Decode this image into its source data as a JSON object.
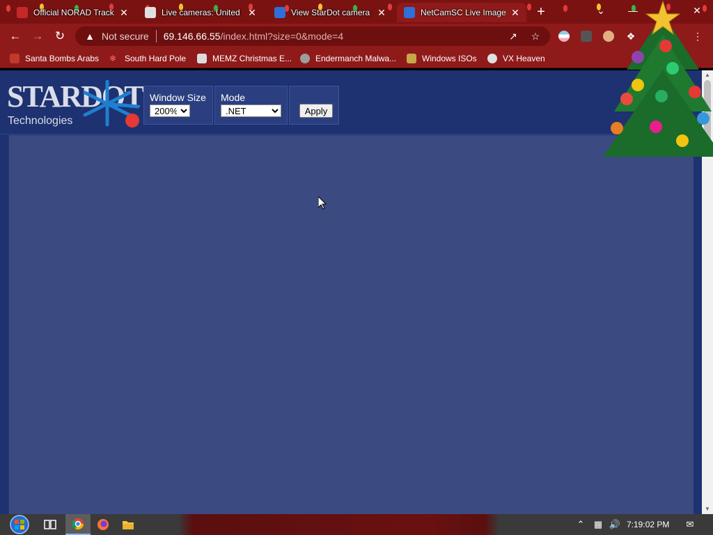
{
  "browser": {
    "tabs": [
      {
        "title": "Official NORAD Tracks",
        "icon": "norad-icon",
        "active": false
      },
      {
        "title": "Live cameras: United S",
        "icon": "camera-icon",
        "active": false
      },
      {
        "title": "View StarDot camera i",
        "icon": "stardot-icon",
        "active": false
      },
      {
        "title": "NetCamSC Live Image",
        "icon": "stardot-icon",
        "active": true
      }
    ],
    "new_tab_symbol": "+",
    "close_symbol": "✕",
    "window_controls": {
      "tab_search": "⌄",
      "minimize": "—",
      "close": "✕"
    },
    "address": {
      "security_label": "Not secure",
      "host": "69.146.66.55",
      "path": "/index.html?size=0&mode=4"
    },
    "bookmarks": [
      {
        "label": "Santa Bombs Arabs",
        "icon": "santa-icon"
      },
      {
        "label": "South Hard Pole",
        "icon": "snowflake-icon"
      },
      {
        "label": "MEMZ Christmas E...",
        "icon": "memz-icon"
      },
      {
        "label": "Endermanch Malwa...",
        "icon": "endermanch-icon"
      },
      {
        "label": "Windows ISOs",
        "icon": "windows-iso-icon"
      },
      {
        "label": "VX Heaven",
        "icon": "vx-heaven-icon"
      }
    ]
  },
  "page": {
    "logo": {
      "brand": "STARDOT",
      "subtitle": "Technologies"
    },
    "controls": {
      "window_size_label": "Window Size",
      "window_size_value": "200%",
      "mode_label": "Mode",
      "mode_value": ".NET",
      "apply_label": "Apply"
    },
    "colors": {
      "header_bg": "#1e3170",
      "frame_bg": "#3c4a82",
      "logo_red": "#e53935",
      "logo_blue": "#1e7fd0"
    }
  },
  "taskbar": {
    "apps": [
      {
        "name": "start-button",
        "icon": "windows-orb-icon"
      },
      {
        "name": "task-view",
        "icon": "task-view-icon"
      },
      {
        "name": "chrome",
        "icon": "chrome-icon"
      },
      {
        "name": "firefox",
        "icon": "firefox-icon"
      },
      {
        "name": "file-explorer",
        "icon": "folder-icon"
      }
    ],
    "clock": "7:19:02 PM"
  }
}
